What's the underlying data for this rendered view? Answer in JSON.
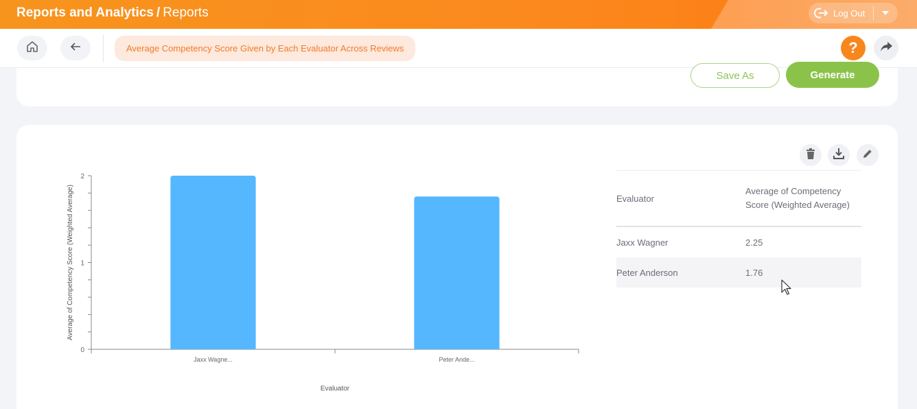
{
  "header": {
    "title": "Reports and Analytics",
    "separator": "/",
    "subtitle": "Reports",
    "logout_label": "Log Out",
    "accent_color": "#f7941d"
  },
  "toolbar": {
    "breadcrumb": "Average Competency Score Given by Each Evaluator Across Reviews",
    "help_label": "?",
    "icons": [
      "home-icon",
      "back-arrow-icon",
      "help-icon",
      "share-icon"
    ]
  },
  "actions": {
    "save_as_label": "Save As",
    "generate_label": "Generate"
  },
  "report_actions": {
    "icons": [
      "trash-icon",
      "download-icon",
      "edit-icon"
    ]
  },
  "table": {
    "columns": [
      "Evaluator",
      "Average of Competency Score (Weighted Average)"
    ],
    "rows": [
      {
        "evaluator": "Jaxx Wagner",
        "score": "2.25"
      },
      {
        "evaluator": "Peter Anderson",
        "score": "1.76"
      }
    ]
  },
  "chart_data": {
    "type": "bar",
    "categories": [
      "Jaxx Wagne...",
      "Peter Ande..."
    ],
    "values": [
      2.25,
      1.76
    ],
    "xlabel": "Evaluator",
    "ylabel": "Average of Competency Score (Weighted Average)",
    "ylim": [
      0,
      2
    ],
    "yticks": [
      "0",
      "1",
      "2"
    ],
    "bar_color": "#55b7fd",
    "grid": false
  }
}
